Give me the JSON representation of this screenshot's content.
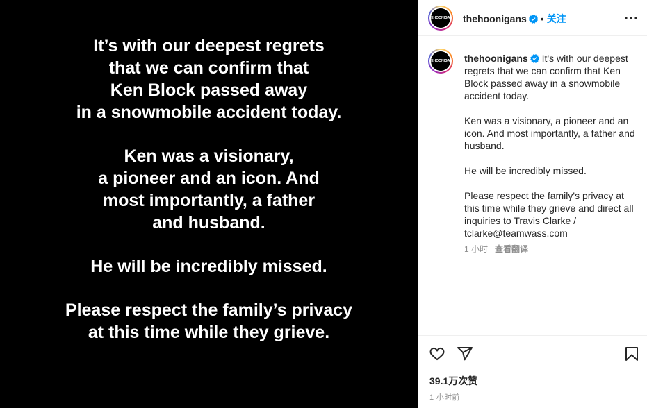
{
  "post_image": {
    "paragraphs": [
      "It’s with our deepest regrets\nthat we can confirm that\nKen Block passed away\nin a snowmobile accident today.",
      "Ken was a visionary,\na pioneer and an icon. And\nmost importantly, a father\nand husband.",
      "He will be incredibly missed.",
      "Please respect the family’s privacy\nat this time while they grieve."
    ]
  },
  "header": {
    "username": "thehoonigans",
    "separator": "•",
    "follow_label": "关注",
    "avatar_text": "THEHOONIGANS",
    "more_icon": "more-horizontal-icon",
    "verified_icon": "verified-badge-icon",
    "verified_color": "#0095f6"
  },
  "caption": {
    "username": "thehoonigans",
    "paragraphs": [
      "It's with our deepest regrets that we can confirm that Ken Block passed away in a snowmobile accident today.",
      "Ken was a visionary, a pioneer and an icon. And most importantly, a father and husband.",
      "He will be incredibly missed.",
      "Please respect the family's privacy at this time while they grieve and direct all inquiries to Travis Clarke / tclarke@teamwass.com"
    ],
    "time": "1 小时",
    "see_translation": "查看翻译"
  },
  "actions": {
    "like_icon": "heart-icon",
    "share_icon": "send-icon",
    "save_icon": "bookmark-icon",
    "likes": "39.1万次赞",
    "timestamp": "1 小时前"
  },
  "colors": {
    "image_bg": "#000000",
    "link_blue": "#0095f6",
    "secondary_text": "#8e8e8e"
  }
}
